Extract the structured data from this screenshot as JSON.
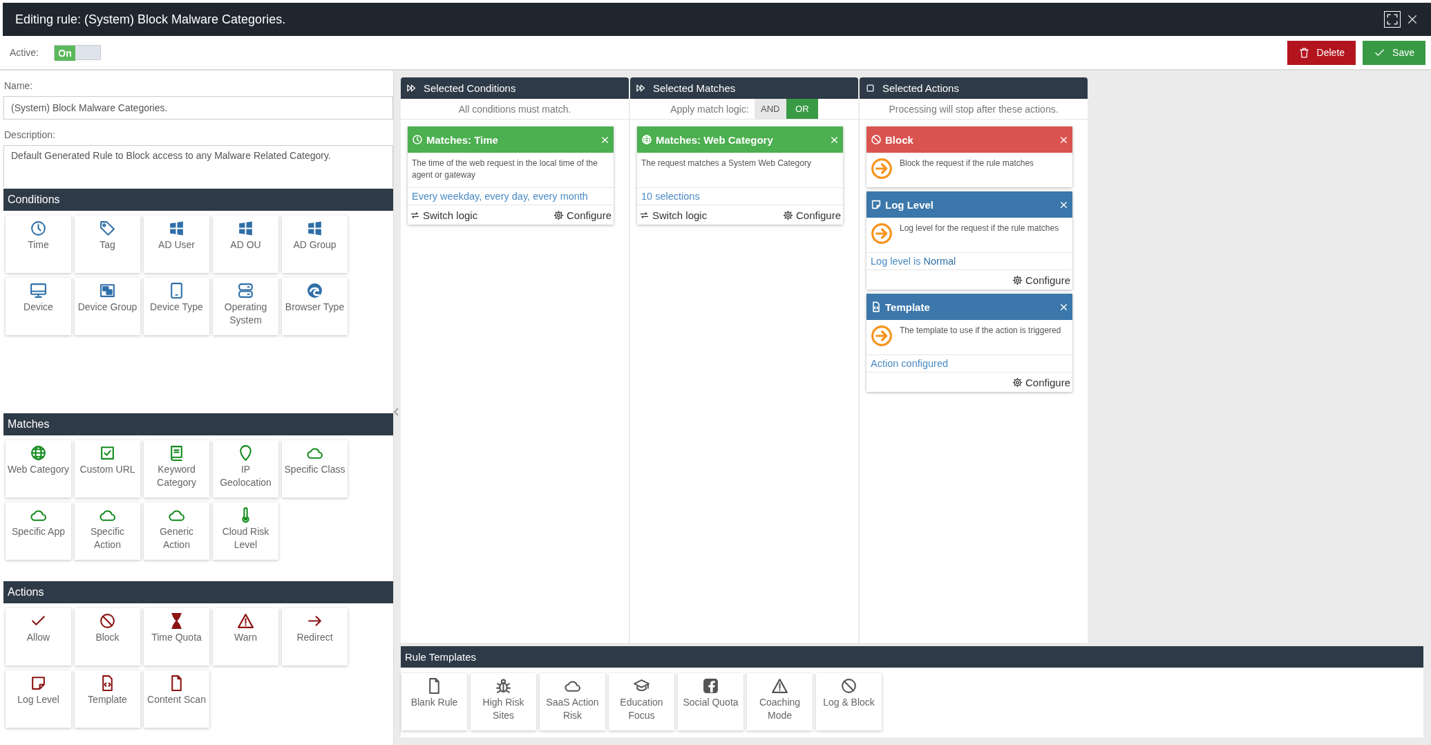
{
  "window": {
    "title": "Editing rule: (System) Block Malware Categories."
  },
  "active": {
    "label": "Active:",
    "toggle": {
      "text": "On",
      "on": true
    }
  },
  "toolbar": {
    "buttons": [
      {
        "kind": "delete",
        "label": "Delete"
      },
      {
        "kind": "save",
        "label": "Save"
      }
    ]
  },
  "name_field": {
    "label": "Name:",
    "value": "(System) Block Malware Categories."
  },
  "description_field": {
    "label": "Description:",
    "value": "Default Generated Rule to Block access to any Malware Related Category."
  },
  "palette": [
    {
      "title": "Conditions",
      "items": [
        "Time",
        "Tag",
        "AD User",
        "AD OU",
        "AD Group",
        "Device",
        "Device Group",
        "Device Type",
        "Operating System",
        "Browser Type"
      ]
    },
    {
      "title": "Matches",
      "items": [
        "Web Category",
        "Custom URL",
        "Keyword Category",
        "IP Geolocation",
        "Specific Class",
        "Specific App",
        "Specific Action",
        "Generic Action",
        "Cloud Risk Level"
      ]
    },
    {
      "title": "Actions",
      "items": [
        "Allow",
        "Block",
        "Time Quota",
        "Warn",
        "Redirect",
        "Log Level",
        "Template",
        "Content Scan"
      ]
    }
  ],
  "selected_conditions": {
    "title": "Selected Conditions",
    "subtitle": "All conditions must match.",
    "cards": [
      {
        "title": "Matches: Time",
        "description": "The time of the web request in the local time of the agent or gateway",
        "summary": "Every weekday, every day, every month",
        "switch": "Switch logic",
        "configure": "Configure"
      }
    ]
  },
  "selected_matches": {
    "title": "Selected Matches",
    "logic_label": "Apply match logic:",
    "logic_options": [
      {
        "label": "AND",
        "selected": false
      },
      {
        "label": "OR",
        "selected": true
      }
    ],
    "cards": [
      {
        "title": "Matches: Web Category",
        "description": "The request matches a System Web Category",
        "summary": "10 selections",
        "switch": "Switch logic",
        "configure": "Configure"
      }
    ]
  },
  "selected_actions": {
    "title": "Selected Actions",
    "subtitle": "Processing will stop after these actions.",
    "cards": [
      {
        "title": "Block",
        "color": "#d9534f",
        "description": "Block the request if the rule matches"
      },
      {
        "title": "Log Level",
        "color": "#3b77aa",
        "description": "Log level for the request if the rule matches",
        "summary": "Log level is **Normal**",
        "configure": "Configure"
      },
      {
        "title": "Template",
        "color": "#3b77aa",
        "description": "The template to use if the action is triggered",
        "summary": "Action configured",
        "configure": "Configure"
      }
    ]
  },
  "rule_templates": {
    "title": "Rule Templates",
    "items": [
      "Blank Rule",
      "High Risk Sites",
      "SaaS Action Risk",
      "Education Focus",
      "Social Quota",
      "Coaching Mode",
      "Log & Block"
    ]
  }
}
